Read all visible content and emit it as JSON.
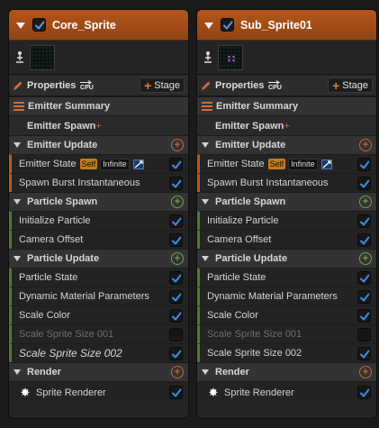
{
  "panels": [
    {
      "title": "Core_Sprite",
      "enabled": true,
      "thumbnail": "dark-noise",
      "properties_label": "Properties",
      "cpu_label": "CPU",
      "stage_label": "Stage",
      "emitter_summary": "Emitter Summary",
      "emitter_spawn": "Emitter Spawn",
      "emitter_update": "Emitter Update",
      "emitter_state": {
        "label": "Emitter State",
        "self": "Self",
        "infinite": "Infinite",
        "checked": true
      },
      "spawn_burst": {
        "label": "Spawn Burst Instantaneous",
        "checked": true
      },
      "particle_spawn": "Particle Spawn",
      "initialize_particle": {
        "label": "Initialize Particle",
        "checked": true
      },
      "camera_offset": {
        "label": "Camera Offset",
        "checked": true
      },
      "particle_update": "Particle Update",
      "particle_state": {
        "label": "Particle State",
        "checked": true
      },
      "dynamic_material": {
        "label": "Dynamic Material Parameters",
        "checked": true
      },
      "scale_color": {
        "label": "Scale Color",
        "checked": true
      },
      "scale_sprite_001": {
        "label": "Scale Sprite Size 001",
        "checked": false
      },
      "scale_sprite_002": {
        "label": "Scale Sprite Size 002",
        "checked": true
      },
      "render": "Render",
      "sprite_renderer": {
        "label": "Sprite Renderer",
        "checked": true
      }
    },
    {
      "title": "Sub_Sprite01",
      "enabled": true,
      "thumbnail": "purple-sparkle",
      "properties_label": "Properties",
      "cpu_label": "CPU",
      "stage_label": "Stage",
      "emitter_summary": "Emitter Summary",
      "emitter_spawn": "Emitter Spawn",
      "emitter_update": "Emitter Update",
      "emitter_state": {
        "label": "Emitter State",
        "self": "Self",
        "infinite": "Infinite",
        "checked": true
      },
      "spawn_burst": {
        "label": "Spawn Burst Instantaneous",
        "checked": true
      },
      "particle_spawn": "Particle Spawn",
      "initialize_particle": {
        "label": "Initialize Particle",
        "checked": true
      },
      "camera_offset": {
        "label": "Camera Offset",
        "checked": true
      },
      "particle_update": "Particle Update",
      "particle_state": {
        "label": "Particle State",
        "checked": true
      },
      "dynamic_material": {
        "label": "Dynamic Material Parameters",
        "checked": true
      },
      "scale_color": {
        "label": "Scale Color",
        "checked": true
      },
      "scale_sprite_001": {
        "label": "Scale Sprite Size 001",
        "checked": false
      },
      "scale_sprite_002": {
        "label": "Scale Sprite Size 002",
        "checked": true
      },
      "render": "Render",
      "sprite_renderer": {
        "label": "Sprite Renderer",
        "checked": true
      }
    }
  ],
  "colors": {
    "header_orange": "#b5561b",
    "check_blue": "#3a8ee6",
    "stage_plus": "#e8792a",
    "section_add_orange": "#c9633a",
    "section_add_green": "#6fa34f"
  }
}
